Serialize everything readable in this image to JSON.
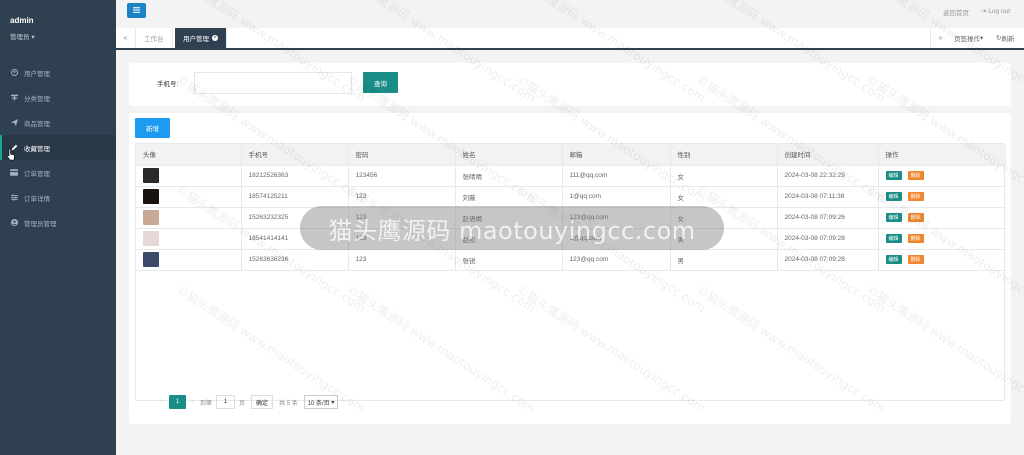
{
  "sidebar": {
    "user_name": "admin",
    "user_role": "管理员",
    "items": [
      {
        "label": "用户管理",
        "icon": "user-circle-icon"
      },
      {
        "label": "分类管理",
        "icon": "category-icon"
      },
      {
        "label": "商品管理",
        "icon": "send-icon"
      },
      {
        "label": "收藏管理",
        "icon": "pencil-icon"
      },
      {
        "label": "订单管理",
        "icon": "card-icon"
      },
      {
        "label": "订单详情",
        "icon": "sliders-icon"
      },
      {
        "label": "管理员管理",
        "icon": "admin-circle-icon"
      }
    ],
    "active_index": 3
  },
  "topbar": {
    "home_link": "返回首页",
    "logout_link": "Log out"
  },
  "tabs": {
    "items": [
      "工作台",
      "用户管理"
    ],
    "active_index": 1,
    "page_ops": "页签操作",
    "refresh": "刷新"
  },
  "search": {
    "label": "手机号:",
    "input_value": "",
    "button": "查询"
  },
  "table": {
    "add_button": "新增",
    "headers": [
      "头像",
      "手机号",
      "密码",
      "姓名",
      "邮箱",
      "性别",
      "创建时间",
      "操作"
    ],
    "rows": [
      {
        "phone": "18212526363",
        "password": "123456",
        "name": "张晴晴",
        "email": "111@qq.com",
        "gender": "女",
        "created": "2024-03-08 22:32:29",
        "avatar_color": "#2a2a2a"
      },
      {
        "phone": "18574125211",
        "password": "123",
        "name": "刘薇",
        "email": "1@qq.com",
        "gender": "女",
        "created": "2024-03-08 07:11:38",
        "avatar_color": "#1a1410"
      },
      {
        "phone": "15263232325",
        "password": "123",
        "name": "赵语嫣",
        "email": "123@qq.com",
        "gender": "女",
        "created": "2024-03-08 07:09:26",
        "avatar_color": "#c9a896"
      },
      {
        "phone": "18541414141",
        "password": "123",
        "name": "赵凯",
        "email": "1@qq.com",
        "gender": "男",
        "created": "2024-03-08 07:09:28",
        "avatar_color": "#e7d8d8"
      },
      {
        "phone": "15263636236",
        "password": "123",
        "name": "张锐",
        "email": "123@qq.com",
        "gender": "男",
        "created": "2024-03-08 07:09:28",
        "avatar_color": "#3b4a66"
      }
    ],
    "edit_label": "编辑",
    "delete_label": "删除"
  },
  "pager": {
    "current_page": "1",
    "goto_label": "到第",
    "goto_value": "1",
    "page_unit": "页",
    "confirm": "确定",
    "total": "共 5 条",
    "page_size": "10 条/页"
  },
  "overlay_text": "猫头鹰源码 maotouyingcc.com",
  "watermark": "©猫头鹰源码 www.maotouyingcc.com"
}
